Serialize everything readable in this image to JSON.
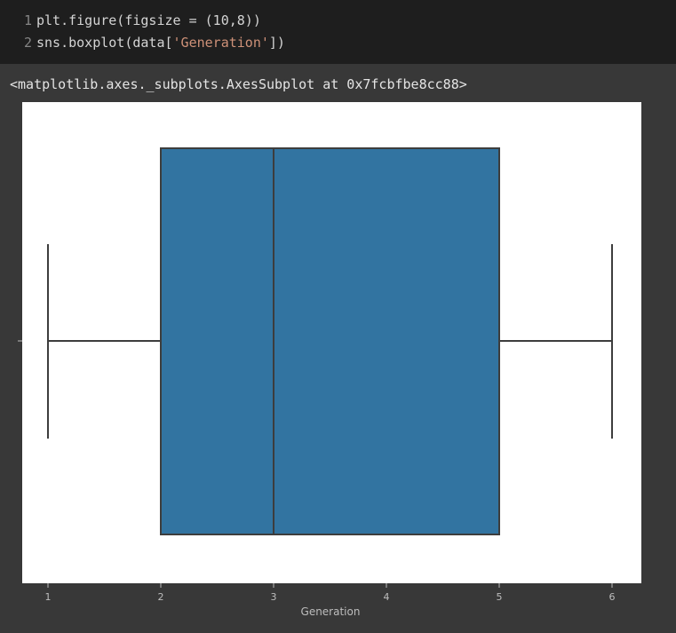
{
  "code_cell": {
    "lines": [
      {
        "number": "1",
        "parts": [
          {
            "text": "plt.figure(figsize = (10,8))",
            "kind": "plain"
          }
        ]
      },
      {
        "number": "2",
        "parts": [
          {
            "text": "sns.boxplot(data[",
            "kind": "plain"
          },
          {
            "text": "'Generation'",
            "kind": "str"
          },
          {
            "text": "])",
            "kind": "plain"
          }
        ]
      }
    ]
  },
  "output": {
    "repr_text": "<matplotlib.axes._subplots.AxesSubplot at 0x7fcbfbe8cc88>"
  },
  "colors": {
    "code_bg": "#1e1e1e",
    "output_bg": "#383838",
    "box_fill": "#3274a1",
    "box_line": "#3d3d3d"
  },
  "chart_data": {
    "type": "box",
    "orient": "horizontal",
    "xlabel": "Generation",
    "ylabel": "",
    "xlim": [
      0.75,
      6.25
    ],
    "xticks": [
      1,
      2,
      3,
      4,
      5,
      6
    ],
    "series": [
      {
        "name": "Generation",
        "whisker_low": 1,
        "q1": 2,
        "median": 3,
        "q3": 5,
        "whisker_high": 6
      }
    ],
    "grid": false
  }
}
